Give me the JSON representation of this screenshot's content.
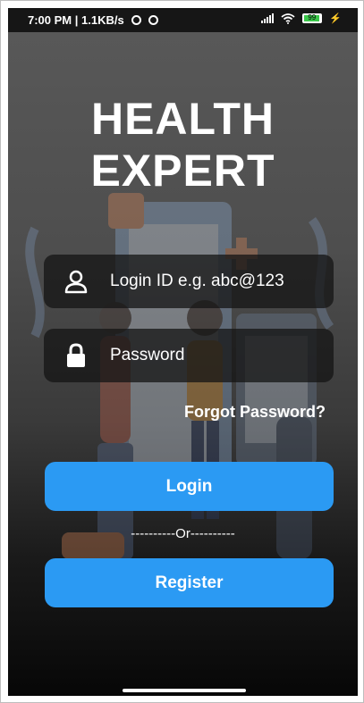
{
  "status_bar": {
    "time_speed": "7:00 PM | 1.1KB/s",
    "battery_level": "99"
  },
  "app": {
    "title_line1": "HEALTH",
    "title_line2": "EXPERT"
  },
  "login_form": {
    "login_id_placeholder": "Login ID e.g. abc@123",
    "password_placeholder": "Password",
    "forgot_password_label": "Forgot Password?",
    "login_button_label": "Login",
    "divider_text": "----------Or----------",
    "register_button_label": "Register"
  },
  "colors": {
    "accent": "#2b9af3",
    "field_background": "#141414"
  },
  "icons": {
    "login_field_icon": "user-icon",
    "password_field_icon": "lock-icon"
  }
}
